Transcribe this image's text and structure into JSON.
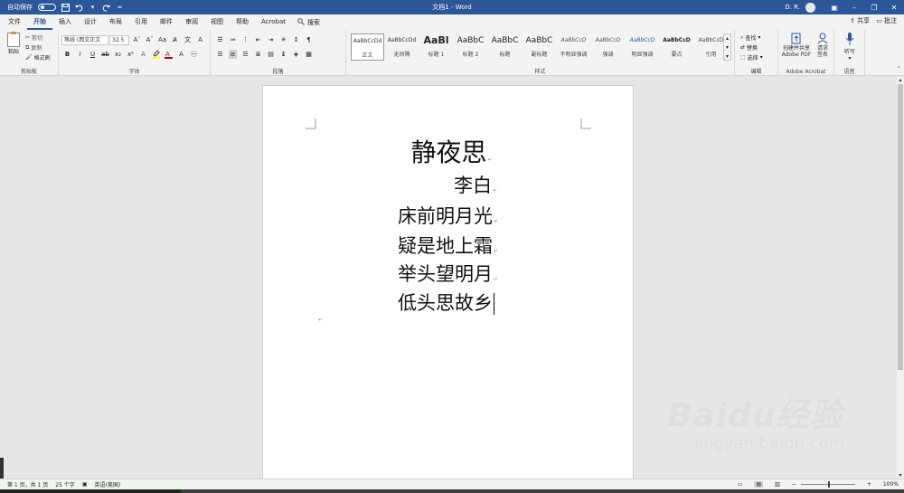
{
  "titlebar": {
    "autosave_label": "自动保存",
    "autosave_state": "关",
    "doc_title": "文档1 - Word",
    "user": "D. R."
  },
  "tabs": [
    "文件",
    "开始",
    "插入",
    "设计",
    "布局",
    "引用",
    "邮件",
    "审阅",
    "视图",
    "帮助",
    "Acrobat"
  ],
  "active_tab": "开始",
  "search_label": "搜索",
  "share_label": "共享",
  "comment_label": "批注",
  "ribbon": {
    "clipboard": {
      "paste": "粘贴",
      "cut": "剪切",
      "copy": "复制",
      "format_painter": "格式刷",
      "label": "剪贴板"
    },
    "font": {
      "name": "等线 (西文正文",
      "size": "32.5",
      "label": "字体"
    },
    "paragraph": {
      "label": "段落"
    },
    "styles": {
      "label": "样式",
      "items": [
        {
          "preview": "AaBbCcDd",
          "name": "正文"
        },
        {
          "preview": "AaBbCcDd",
          "name": "无间隔"
        },
        {
          "preview": "AaBl",
          "name": "标题 1"
        },
        {
          "preview": "AaBbC",
          "name": "标题 2"
        },
        {
          "preview": "AaBbC",
          "name": "标题"
        },
        {
          "preview": "AaBbC",
          "name": "副标题"
        },
        {
          "preview": "AaBbCcD",
          "name": "不明显强调"
        },
        {
          "preview": "AaBbCcD",
          "name": "强调"
        },
        {
          "preview": "AaBbCcD",
          "name": "明显强调"
        },
        {
          "preview": "AaBbCcD",
          "name": "要点"
        },
        {
          "preview": "AaBbCcD",
          "name": "引用"
        }
      ]
    },
    "editing": {
      "find": "查找",
      "replace": "替换",
      "select": "选择",
      "label": "编辑"
    },
    "acrobat": {
      "create_share": "创建并共享 Adobe PDF",
      "request_sign": "请求签名",
      "label": "Adobe Acrobat"
    },
    "voice": {
      "dictate": "听写",
      "label": "语音"
    }
  },
  "document": {
    "title": "静夜思",
    "author": "李白",
    "lines": [
      "床前明月光",
      "疑是地上霜",
      "举头望明月",
      "低头思故乡"
    ]
  },
  "status": {
    "page": "第 1 页，共 1 页",
    "words": "25 个字",
    "language": "英语(美国)",
    "zoom": "100%"
  },
  "watermark": {
    "brand": "Baidu经验",
    "url": "jingyan.baidu.com"
  },
  "colors": {
    "accent": "#2b579a",
    "font_color": "#c00000",
    "highlight": "#ffff00"
  }
}
